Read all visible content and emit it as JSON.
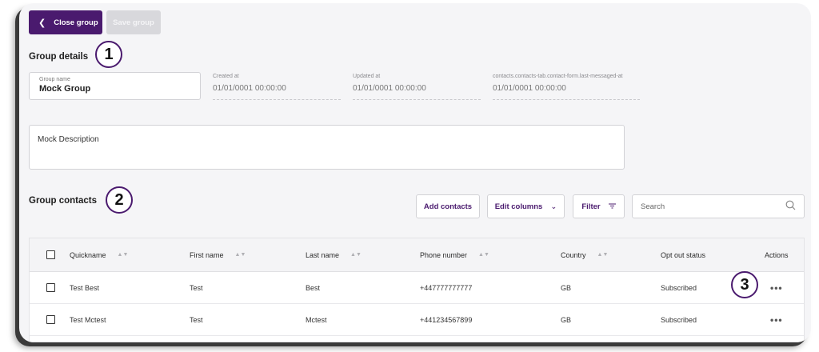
{
  "toolbar": {
    "close_label": "Close group",
    "save_label": "Save group"
  },
  "group_details": {
    "title": "Group details",
    "badge": "1",
    "name_label": "Group name",
    "name_value": "Mock Group",
    "created_label": "Created at",
    "created_value": "01/01/0001 00:00:00",
    "updated_label": "Updated at",
    "updated_value": "01/01/0001 00:00:00",
    "last_messaged_label": "contacts.contacts-tab.contact-form.last-messaged-at",
    "last_messaged_value": "01/01/0001 00:00:00",
    "description": "Mock Description"
  },
  "group_contacts": {
    "title": "Group contacts",
    "badge": "2",
    "add_label": "Add contacts",
    "edit_columns_label": "Edit columns",
    "filter_label": "Filter",
    "search_placeholder": "Search"
  },
  "table": {
    "headers": {
      "quickname": "Quickname",
      "first_name": "First name",
      "last_name": "Last name",
      "phone": "Phone number",
      "country": "Country",
      "opt_out": "Opt out status",
      "actions": "Actions"
    },
    "rows": [
      {
        "quickname": "Test Best",
        "first_name": "Test",
        "last_name": "Best",
        "phone": "+447777777777",
        "country": "GB",
        "opt_out": "Subscribed"
      },
      {
        "quickname": "Test Mctest",
        "first_name": "Test",
        "last_name": "Mctest",
        "phone": "+441234567899",
        "country": "GB",
        "opt_out": "Subscribed"
      }
    ],
    "actions_badge": "3"
  },
  "colors": {
    "accent": "#4a1a6e",
    "disabled": "#d8d8dc",
    "background": "#f5f5f7"
  },
  "icons": [
    "chevron-left-icon",
    "chevron-down-icon",
    "filter-icon",
    "search-icon",
    "sort-icon",
    "more-icon",
    "checkbox-icon"
  ]
}
